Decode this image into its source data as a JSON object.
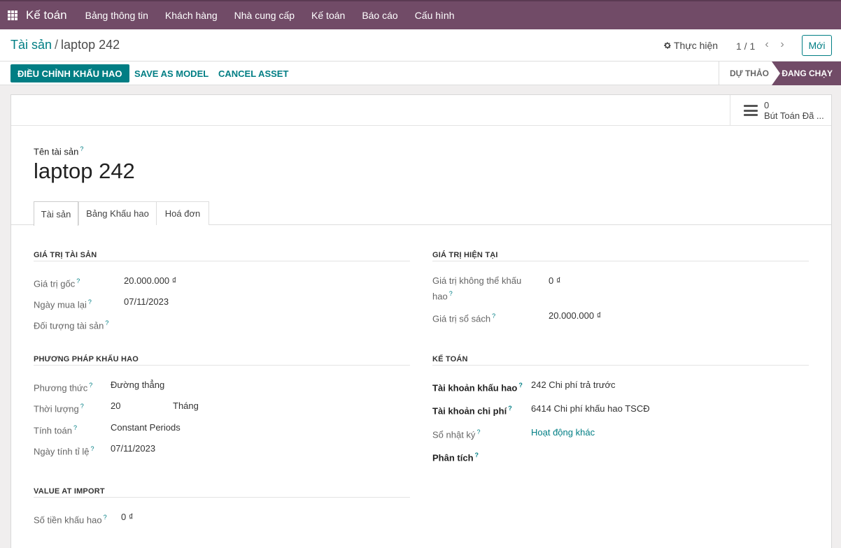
{
  "nav": {
    "app_title": "Kế toán",
    "items": [
      "Bảng thông tin",
      "Khách hàng",
      "Nhà cung cấp",
      "Kế toán",
      "Báo cáo",
      "Cấu hình"
    ]
  },
  "control": {
    "breadcrumb_parent": "Tài sản",
    "breadcrumb_current": "laptop 242",
    "action_label": "Thực hiện",
    "pager": "1 / 1",
    "new_label": "Mới"
  },
  "status": {
    "primary_button": "ĐIỀU CHỈNH KHẤU HAO",
    "save_model": "SAVE AS MODEL",
    "cancel_asset": "CANCEL ASSET",
    "stage_draft": "DỰ THẢO",
    "stage_running": "ĐANG CHẠY"
  },
  "smart_button": {
    "count": "0",
    "label": "Bút Toán Đã ..."
  },
  "form": {
    "name_label": "Tên tài sản",
    "name_value": "laptop 242",
    "help_mark": "?",
    "tabs": [
      "Tài sản",
      "Bảng Khấu hao",
      "Hoá đơn"
    ],
    "asset_value": {
      "title": "GIÁ TRỊ TÀI SẢN",
      "original_value_label": "Giá trị gốc",
      "original_value": "20.000.000 ₫",
      "acquisition_date_label": "Ngày mua lại",
      "acquisition_date": "07/11/2023",
      "partner_label": "Đối tượng tài sản"
    },
    "current_value": {
      "title": "GIÁ TRỊ HIỆN TẠI",
      "non_depreciable_label_1": "Giá trị không thể khấu",
      "non_depreciable_label_2": "hao",
      "non_depreciable_value": "0 ₫",
      "book_value_label": "Giá trị sổ sách",
      "book_value": "20.000.000 ₫"
    },
    "method": {
      "title": "PHƯƠNG PHÁP KHẤU HAO",
      "method_label": "Phương thức",
      "method_value": "Đường thẳng",
      "duration_label": "Thời lượng",
      "duration_value": "20",
      "duration_unit": "Tháng",
      "computation_label": "Tính toán",
      "computation_value": "Constant Periods",
      "prorata_label": "Ngày tính tỉ lệ",
      "prorata_value": "07/11/2023"
    },
    "accounting": {
      "title": "KẾ TOÁN",
      "depreciation_account_label": "Tài khoản khấu hao",
      "depreciation_account": "242 Chi phí trả trước",
      "expense_account_label": "Tài khoản chi phí",
      "expense_account": "6414 Chi phí khấu hao TSCĐ",
      "journal_label": "Sổ nhật ký",
      "journal_value": "Hoạt động khác",
      "analytic_label": "Phân tích"
    },
    "import": {
      "title": "VALUE AT IMPORT",
      "depreciated_amount_label": "Số tiền khấu hao",
      "depreciated_amount": "0 ₫"
    }
  },
  "colors": {
    "brand": "#714b67",
    "accent": "#017e84"
  }
}
